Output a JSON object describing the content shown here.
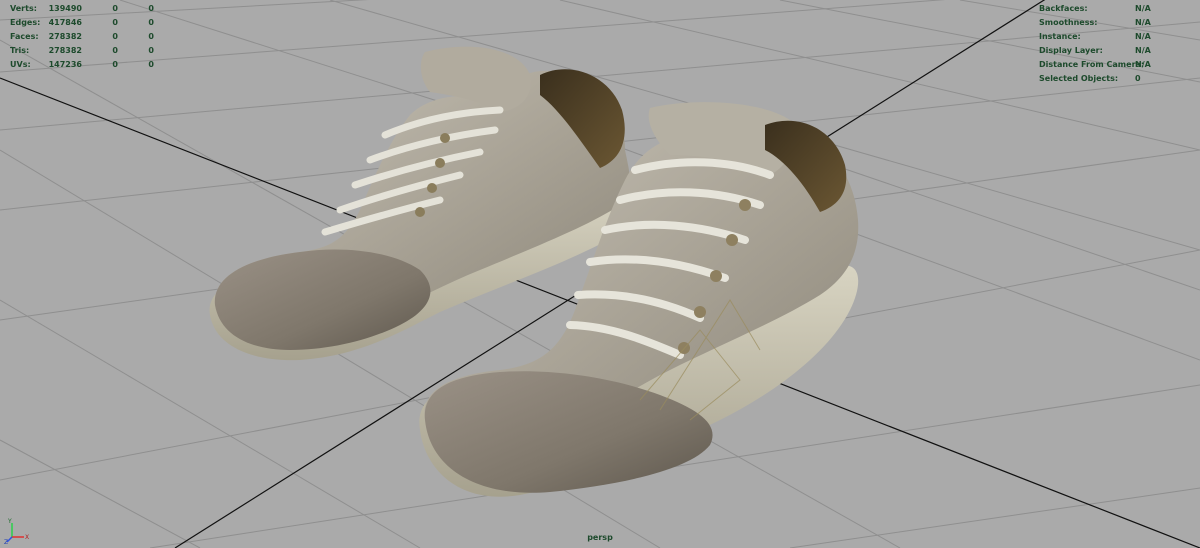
{
  "viewport": {
    "camera_name": "persp",
    "stats_left": [
      {
        "label": "Verts:",
        "values": [
          "139490",
          "0",
          "0"
        ]
      },
      {
        "label": "Edges:",
        "values": [
          "417846",
          "0",
          "0"
        ]
      },
      {
        "label": "Faces:",
        "values": [
          "278382",
          "0",
          "0"
        ]
      },
      {
        "label": "Tris:",
        "values": [
          "278382",
          "0",
          "0"
        ]
      },
      {
        "label": "UVs:",
        "values": [
          "147236",
          "0",
          "0"
        ]
      }
    ],
    "stats_right": [
      {
        "label": "Backfaces:",
        "value": "N/A"
      },
      {
        "label": "Smoothness:",
        "value": "N/A"
      },
      {
        "label": "Instance:",
        "value": "N/A"
      },
      {
        "label": "Display Layer:",
        "value": "N/A"
      },
      {
        "label": "Distance From Camera:",
        "value": "N/A"
      },
      {
        "label": "Selected Objects:",
        "value": "0"
      }
    ],
    "axis": {
      "y": "Y",
      "x": "X",
      "z": "Z"
    },
    "colors": {
      "background": "#aaaaaa",
      "grid_line": "#8e8e8e",
      "axis_line": "#111111",
      "hud_text": "#1d4a2c",
      "shoe_suede": "#8d8478",
      "shoe_canvas": "#b8b3a6",
      "shoe_sole": "#ccc8b4"
    },
    "scene_object": "sneakers-model"
  }
}
